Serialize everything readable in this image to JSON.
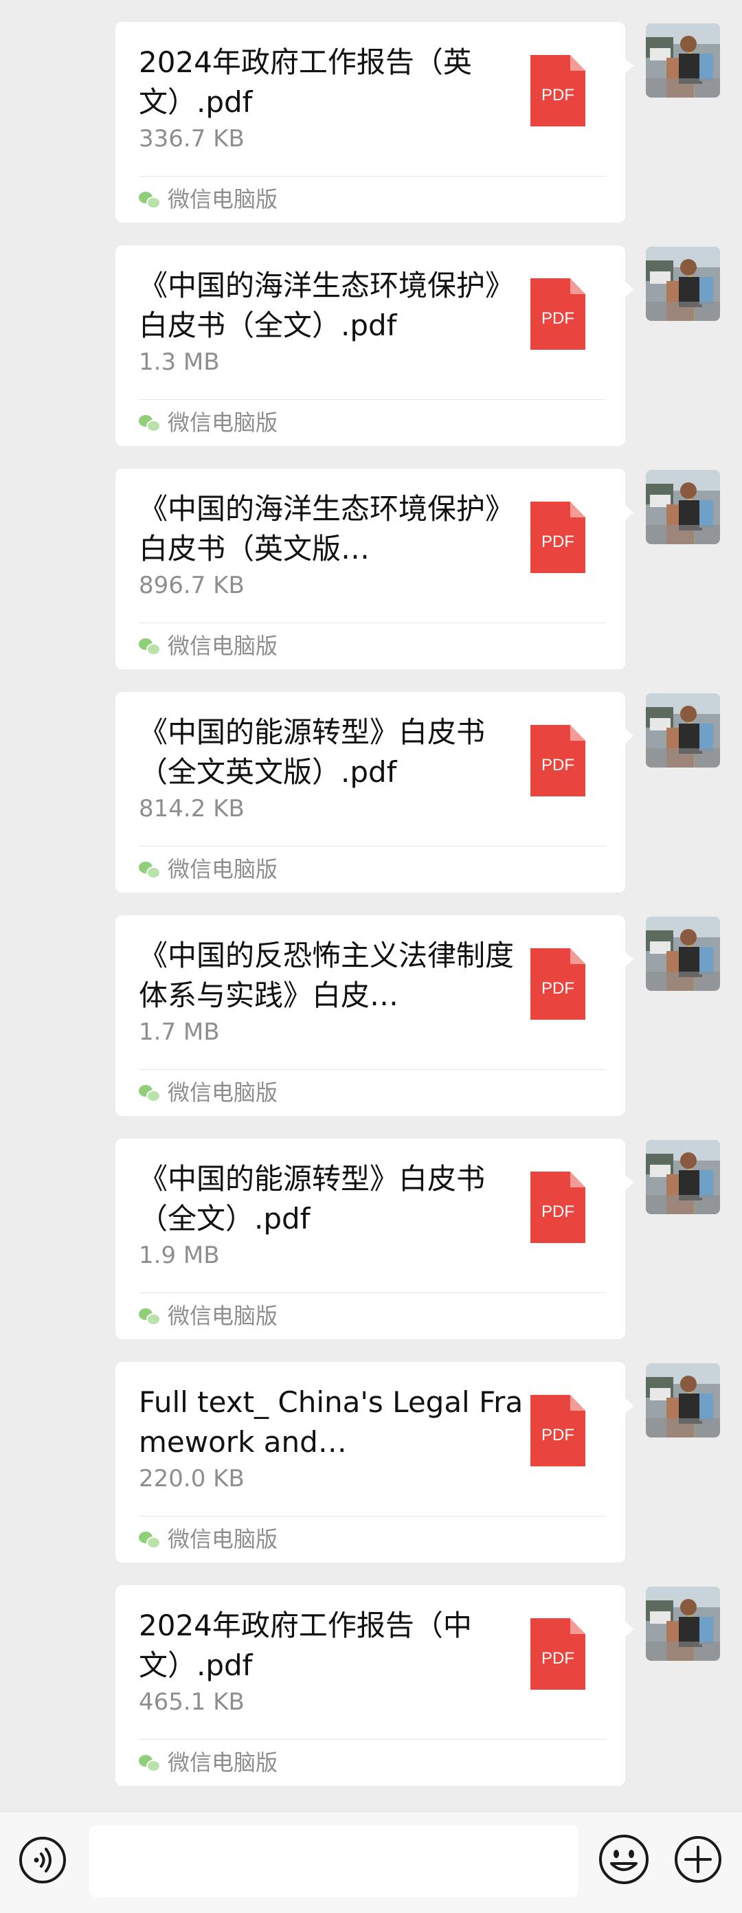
{
  "messages": [
    {
      "filename": "2024年政府工作报告（英文）.pdf",
      "size": "336.7 KB",
      "source": "微信电脑版",
      "file_type": "PDF"
    },
    {
      "filename": "《中国的海洋生态环境保护》白皮书（全文）.pdf",
      "size": "1.3 MB",
      "source": "微信电脑版",
      "file_type": "PDF"
    },
    {
      "filename": "《中国的海洋生态环境保护》白皮书（英文版…",
      "size": "896.7 KB",
      "source": "微信电脑版",
      "file_type": "PDF"
    },
    {
      "filename": "《中国的能源转型》白皮书（全文英文版）.pdf",
      "size": "814.2 KB",
      "source": "微信电脑版",
      "file_type": "PDF"
    },
    {
      "filename": "《中国的反恐怖主义法律制度体系与实践》白皮…",
      "size": "1.7 MB",
      "source": "微信电脑版",
      "file_type": "PDF"
    },
    {
      "filename": "《中国的能源转型》白皮书（全文）.pdf",
      "size": "1.9 MB",
      "source": "微信电脑版",
      "file_type": "PDF"
    },
    {
      "filename": "Full text_ China's Legal Framework and…",
      "size": "220.0 KB",
      "source": "微信电脑版",
      "file_type": "PDF"
    },
    {
      "filename": "2024年政府工作报告（中文）.pdf",
      "size": "465.1 KB",
      "source": "微信电脑版",
      "file_type": "PDF"
    }
  ],
  "input_bar": {
    "voice_icon": "voice-icon",
    "input_value": "",
    "emoji_icon": "emoji-icon",
    "plus_icon": "plus-icon"
  },
  "colors": {
    "background": "#ededed",
    "bubble": "#ffffff",
    "pdf_red": "#e9443d",
    "secondary_text": "#8e8e8e"
  }
}
